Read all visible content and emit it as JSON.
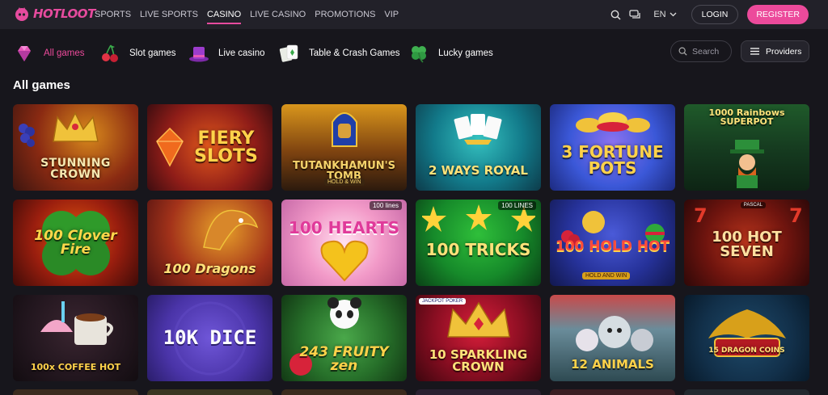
{
  "brand": {
    "name": "HOTLOOT",
    "accent": "#ec4a9b"
  },
  "nav": {
    "items": [
      {
        "label": "SPORTS",
        "active": false
      },
      {
        "label": "LIVE SPORTS",
        "active": false
      },
      {
        "label": "CASINO",
        "active": true
      },
      {
        "label": "LIVE CASINO",
        "active": false
      },
      {
        "label": "PROMOTIONS",
        "active": false
      },
      {
        "label": "VIP",
        "active": false
      }
    ]
  },
  "header": {
    "language": "EN",
    "login_label": "LOGIN",
    "register_label": "REGISTER",
    "icons": [
      "search-icon",
      "chat-icon",
      "chevron-down-icon"
    ]
  },
  "categories": [
    {
      "label": "All games",
      "icon": "gem-icon",
      "active": true
    },
    {
      "label": "Slot games",
      "icon": "cherries-icon",
      "active": false
    },
    {
      "label": "Live casino",
      "icon": "top-hat-icon",
      "active": false
    },
    {
      "label": "Table & Crash Games",
      "icon": "cards-icon",
      "active": false
    },
    {
      "label": "Lucky games",
      "icon": "clover-icon",
      "active": false
    }
  ],
  "search": {
    "placeholder": "Search"
  },
  "providers_label": "Providers",
  "section_title": "All games",
  "games": [
    {
      "title": "STUNNING CROWN"
    },
    {
      "title": "FIERY SLOTS"
    },
    {
      "title": "TUTANKHAMUN'S TOMB",
      "subtitle": "HOLD & WIN"
    },
    {
      "title": "2 WAYS ROYAL"
    },
    {
      "title": "3 FORTUNE POTS"
    },
    {
      "title": "1000 Rainbows SUPERPOT"
    },
    {
      "title": "100 Clover Fire"
    },
    {
      "title": "100 Dragons"
    },
    {
      "title": "100 HEARTS",
      "badge": "100 lines"
    },
    {
      "title": "100 TRICKS",
      "badge": "100 LINES"
    },
    {
      "title": "100 HOLD HOT",
      "subtitle": "HOLD AND WIN"
    },
    {
      "title": "100 HOT SEVEN",
      "badge": "PASCAL"
    },
    {
      "title": "100x COFFEE HOT"
    },
    {
      "title": "10K DICE"
    },
    {
      "title": "243 FRUITY zen"
    },
    {
      "title": "10 SPARKLING CROWN",
      "badge": "JACKPOT POKER"
    },
    {
      "title": "12 ANIMALS"
    },
    {
      "title": "15 DRAGON COINS"
    }
  ]
}
